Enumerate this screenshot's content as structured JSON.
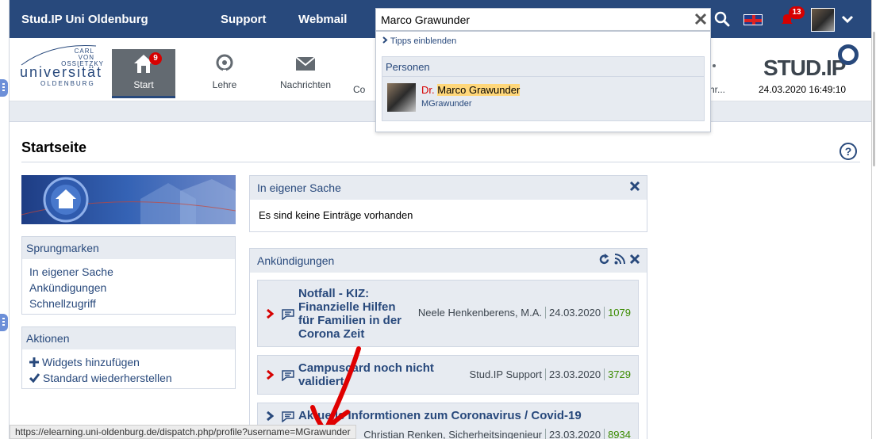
{
  "topbar": {
    "brand": "Stud.IP Uni Oldenburg",
    "links": [
      "Support",
      "Webmail"
    ],
    "notification_count": "13"
  },
  "search": {
    "value": "Marco Grawunder",
    "tips_label": "Tipps einblenden",
    "category_label": "Personen",
    "result": {
      "title": "Dr.",
      "name": "Marco Grawunder",
      "username": "MGrawunder"
    }
  },
  "logo": {
    "lines": [
      "CARL",
      "VON",
      "OSSIETZKY"
    ],
    "name": "universität",
    "city": "OLDENBURG"
  },
  "nav": {
    "items": [
      {
        "label": "Start",
        "badge": "9"
      },
      {
        "label": "Lehre"
      },
      {
        "label": "Nachrichten"
      },
      {
        "label": "Co"
      },
      {
        "label": "hr..."
      }
    ]
  },
  "studip_logo": "STUD.IP",
  "datetime": "24.03.2020 16:49:10",
  "page_title": "Startseite",
  "help_label": "?",
  "sidebar": {
    "jump_header": "Sprungmarken",
    "jump_links": [
      "In eigener Sache",
      "Ankündigungen",
      "Schnellzugriff"
    ],
    "actions_header": "Aktionen",
    "actions": [
      "Widgets hinzufügen",
      "Standard wiederherstellen"
    ]
  },
  "widgets": {
    "own": {
      "title": "In eigener Sache",
      "empty_text": "Es sind keine Einträge vorhanden"
    },
    "announcements": {
      "title": "Ankündigungen",
      "items": [
        {
          "title": "Notfall - KIZ: Finanzielle Hilfen für Familien in der Corona Zeit",
          "author": "Neele Henkenberens, M.A.",
          "date": "24.03.2020",
          "views": "1079"
        },
        {
          "title": "Campuscard noch nicht validiert",
          "author": "Stud.IP Support",
          "date": "23.03.2020",
          "views": "3729"
        },
        {
          "title": "Aktuelle Informtionen zum Coronavirus / Covid-19",
          "author": "Christian Renken, Sicherheitsingenieur",
          "date": "23.03.2020",
          "views": "8934"
        }
      ]
    }
  },
  "status_url": "https://elearning.uni-oldenburg.de/dispatch.php/profile?username=MGrawunder",
  "colors": {
    "brand": "#28497c",
    "badge": "#d60000",
    "views": "#3a8b00",
    "highlight": "#ffd77a",
    "annotation": "#e00000"
  }
}
